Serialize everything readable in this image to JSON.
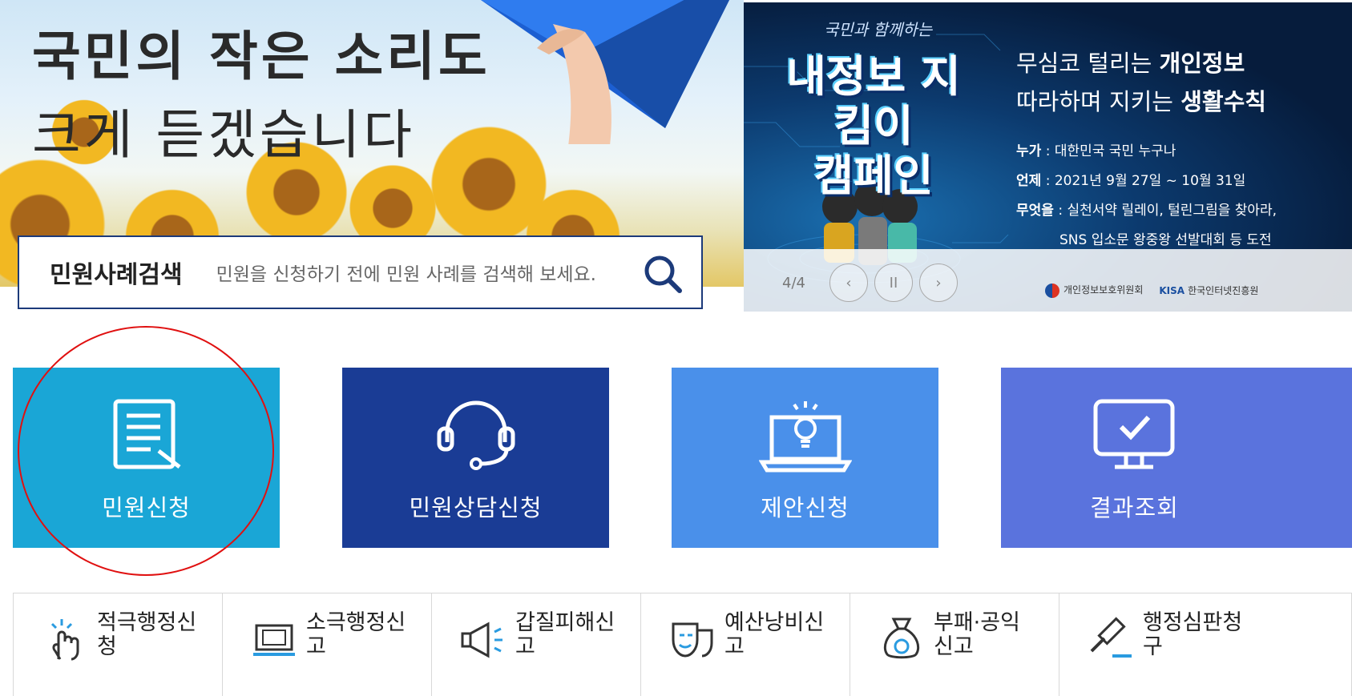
{
  "hero": {
    "line1": "국민의 작은 소리도",
    "line2": "크게 듣겠습니다"
  },
  "search": {
    "label": "민원사례검색",
    "placeholder": "민원을 신청하기 전에 민원 사례를 검색해 보세요.",
    "button_icon": "search-icon"
  },
  "banner": {
    "small": "국민과 함께하는",
    "big_line1": "내정보 지킴이",
    "big_line2": "캠페인",
    "head_line1_plain": "무심코 털리는 ",
    "head_line1_bold": "개인정보",
    "head_line2_plain": "따라하며 지키는 ",
    "head_line2_bold": "생활수칙",
    "who_label": "누가",
    "who_value": ": 대한민국 국민 누구나",
    "when_label": "언제",
    "when_value": ": 2021년 9월 27일 ~ 10월 31일",
    "what_label": "무엇을",
    "what_value": ": 실천서약 릴레이, 털린그림을 찾아라,",
    "what_value2": "SNS 입소문 왕중왕 선발대회 등 도전",
    "pager_count": "4/4",
    "prev_icon": "‹",
    "pause_icon": "II",
    "next_icon": "›",
    "logo1": "개인정보보호위원회",
    "logo2_mark": "KISA",
    "logo2": "한국인터넷진흥원"
  },
  "tiles": [
    {
      "label": "민원신청",
      "icon": "document-icon",
      "color": "#1aa6d6"
    },
    {
      "label": "민원상담신청",
      "icon": "headset-icon",
      "color": "#1a3c95"
    },
    {
      "label": "제안신청",
      "icon": "lightbulb-laptop-icon",
      "color": "#4a90ea"
    },
    {
      "label": "결과조회",
      "icon": "monitor-check-icon",
      "color": "#5a73dd"
    }
  ],
  "links": [
    {
      "label": "적극행정신청",
      "icon": "pointer-hand-icon"
    },
    {
      "label": "소극행정신고",
      "icon": "laptop-icon"
    },
    {
      "label": "갑질피해신고",
      "icon": "megaphone-icon"
    },
    {
      "label": "예산낭비신고",
      "icon": "theater-mask-icon"
    },
    {
      "label": "부패·공익 신고",
      "icon": "money-bag-icon"
    },
    {
      "label": "행정심판청구",
      "icon": "gavel-icon"
    }
  ]
}
